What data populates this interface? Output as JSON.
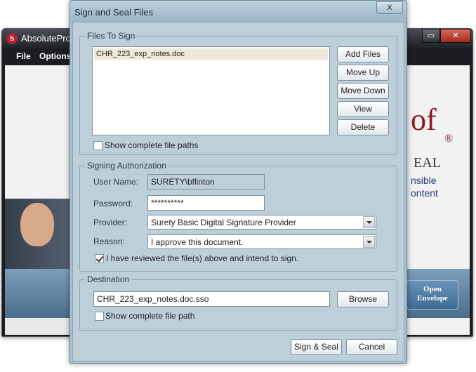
{
  "background_app": {
    "title": "AbsoluteProof",
    "menu": [
      "File",
      "Options"
    ],
    "brand_text": "of",
    "brand_mark": "®",
    "brand_sub": "EAL",
    "tagline_1": "nsible",
    "tagline_2": "ontent",
    "open_envelope_1": "Open",
    "open_envelope_2": "Envelope"
  },
  "dialog": {
    "title": "Sign and Seal Files",
    "close_label": "X",
    "files_group": {
      "legend": "Files To Sign",
      "files": [
        "CHR_223_exp_notes.doc"
      ],
      "buttons": {
        "add": "Add Files",
        "move_up": "Move Up",
        "move_down": "Move Down",
        "view": "View",
        "delete": "Delete"
      },
      "show_paths_label": "Show complete file paths",
      "show_paths_checked": false
    },
    "signing_group": {
      "legend": "Signing Authorization",
      "user_name_label": "User Name:",
      "user_name_value": "SURETY\\bflinton",
      "password_label": "Password:",
      "password_value": "**********",
      "provider_label": "Provider:",
      "provider_value": "Surety Basic Digital Signature Provider",
      "reason_label": "Reason:",
      "reason_value": "I approve this document.",
      "reviewed_label": "I have reviewed the file(s) above and intend to sign.",
      "reviewed_checked": true
    },
    "destination_group": {
      "legend": "Destination",
      "path_value": "CHR_223_exp_notes.doc.sso",
      "browse_label": "Browse",
      "show_path_label": "Show complete file path",
      "show_path_checked": false
    },
    "footer": {
      "sign_seal_label": "Sign & Seal",
      "cancel_label": "Cancel"
    }
  }
}
